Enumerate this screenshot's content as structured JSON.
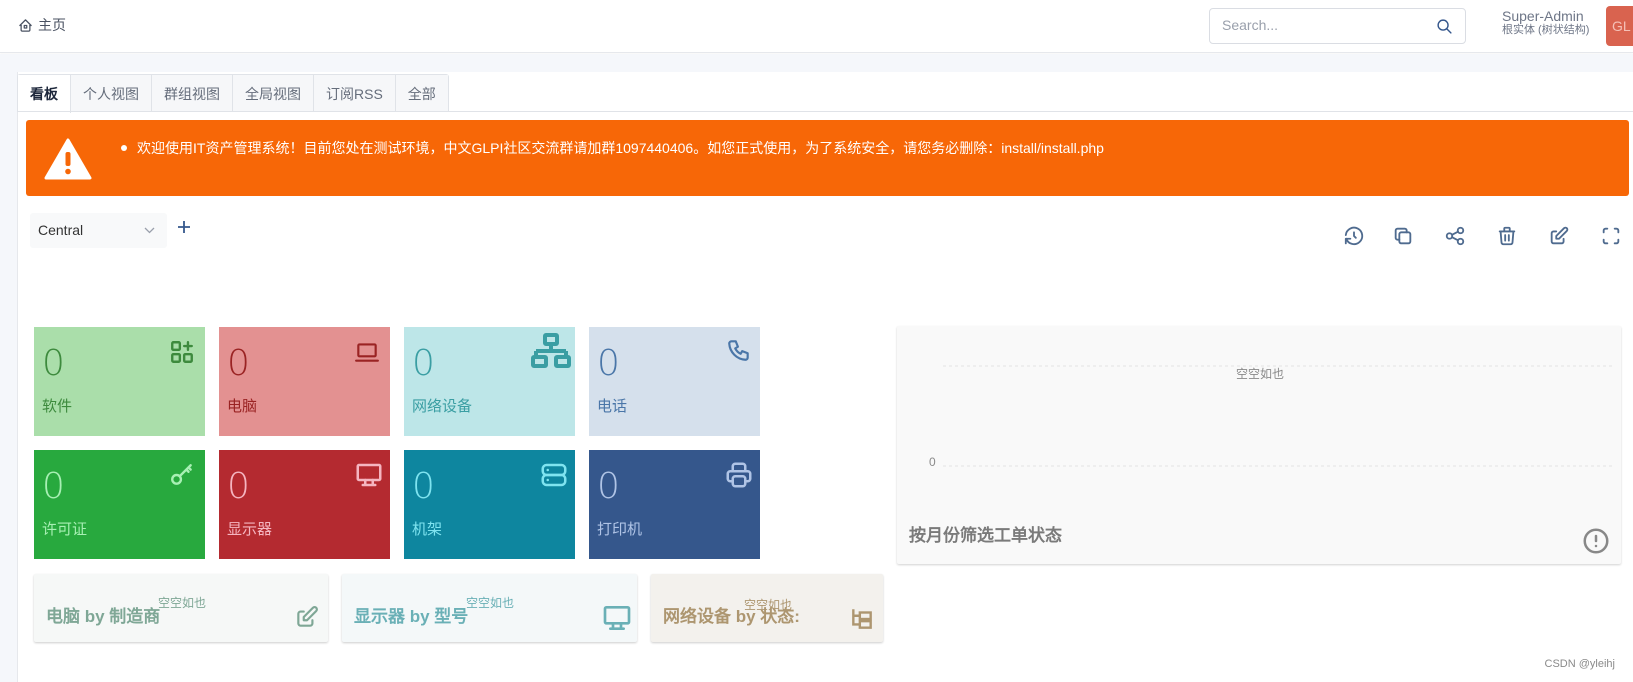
{
  "header": {
    "breadcrumb_home_icon": "home-icon",
    "breadcrumb_label": "主页",
    "search": {
      "placeholder": "Search...",
      "value": "",
      "icon": "search-icon"
    },
    "user": {
      "name": "Super-Admin",
      "entity": "根实体 (树状结构)",
      "avatar_initials": "GL",
      "avatar_color": "#d9634f"
    }
  },
  "tabs": [
    {
      "label": "看板",
      "active": true
    },
    {
      "label": "个人视图",
      "active": false
    },
    {
      "label": "群组视图",
      "active": false
    },
    {
      "label": "全局视图",
      "active": false
    },
    {
      "label": "订阅RSS",
      "active": false
    },
    {
      "label": "全部",
      "active": false
    }
  ],
  "alert": {
    "icon": "warning-triangle-icon",
    "color": "#f76707",
    "message": "欢迎使用IT资产管理系统！目前您处在测试环境，中文GLPI社区交流群请加群1097440406。如您正式使用，为了系统安全，请您务必删除：install/install.php"
  },
  "dashboard": {
    "selected": "Central",
    "add_icon": "plus-icon",
    "toolbar_icons": [
      "history-icon",
      "clone-icon",
      "share-icon",
      "trash-icon",
      "edit-icon",
      "fullscreen-icon"
    ]
  },
  "cards": [
    {
      "value": "0",
      "label": "软件",
      "icon": "apps-plus-icon",
      "bg": "#aadeaa",
      "fg": "#3d8a3d"
    },
    {
      "value": "0",
      "label": "电脑",
      "icon": "laptop-icon",
      "bg": "#e39191",
      "fg": "#9a2323"
    },
    {
      "value": "0",
      "label": "网络设备",
      "icon": "network-icon",
      "bg": "#bde6e8",
      "fg": "#3a9ea3"
    },
    {
      "value": "0",
      "label": "电话",
      "icon": "phone-icon",
      "bg": "#d5e0ec",
      "fg": "#4a76a8"
    },
    {
      "value": "0",
      "label": "许可证",
      "icon": "key-icon",
      "bg": "#28a93e",
      "fg": "#a8f0b4"
    },
    {
      "value": "0",
      "label": "显示器",
      "icon": "monitor-icon",
      "bg": "#b42a30",
      "fg": "#f5b5c0"
    },
    {
      "value": "0",
      "label": "机架",
      "icon": "server-icon",
      "bg": "#0e869f",
      "fg": "#7fe4f0"
    },
    {
      "value": "0",
      "label": "打印机",
      "icon": "printer-icon",
      "bg": "#35578c",
      "fg": "#b0c4e6"
    }
  ],
  "mini_widgets": [
    {
      "title": "电脑 by 制造商",
      "empty": "空空如也",
      "icon": "edit-icon",
      "bg": "#f6f8f7",
      "fg": "#7fa796"
    },
    {
      "title": "显示器 by 型号",
      "empty": "空空如也",
      "icon": "monitor-icon",
      "bg": "#f4f8f9",
      "fg": "#6ab0b6"
    },
    {
      "title": "网络设备 by 状态:",
      "empty": "空空如也",
      "icon": "tree-icon",
      "bg": "#f3f1ed",
      "fg": "#ad9670"
    }
  ],
  "ticket_chart": {
    "title": "按月份筛选工单状态",
    "icon": "alert-circle-icon",
    "empty": "空空如也"
  },
  "chart_data": {
    "type": "line",
    "title": "按月份筛选工单状态",
    "series": [],
    "y_ticks": [
      "0"
    ],
    "annotations": [
      "空空如也"
    ],
    "grid": true
  },
  "footer": {
    "credit": "CSDN @yleihj"
  }
}
